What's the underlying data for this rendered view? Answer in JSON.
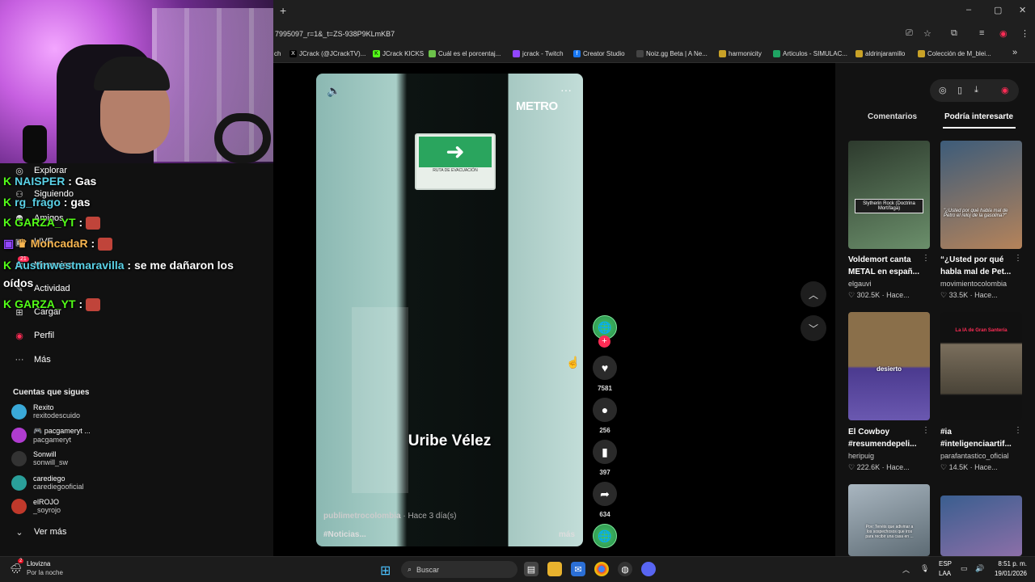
{
  "browser": {
    "new_tab": "+",
    "url": "7995097_r=1&_t=ZS-938P9KLmKB7",
    "window_controls": [
      "–",
      "▢",
      "✕"
    ],
    "bookmarks": [
      {
        "label": "ch",
        "icon": "tiktok-icon"
      },
      {
        "label": "JCrack (@JCrackTV)...",
        "icon": "x-icon"
      },
      {
        "label": "JCrack KICKS",
        "icon": "kick-icon"
      },
      {
        "label": "Cuál es el porcentaj...",
        "icon": "page-icon"
      },
      {
        "label": "jcrack - Twitch",
        "icon": "twitch-icon"
      },
      {
        "label": "Creator Studio",
        "icon": "facebook-icon"
      },
      {
        "label": "Noiz.gg Beta | A Ne...",
        "icon": "noiz-icon"
      },
      {
        "label": "harmonicity",
        "icon": "folder-icon"
      },
      {
        "label": "Articulos - SIMULAC...",
        "icon": "drive-icon"
      },
      {
        "label": "aldrinjaramillo",
        "icon": "folder-icon"
      },
      {
        "label": "Colección de M_blei...",
        "icon": "folder-icon"
      }
    ],
    "bookmarks_overflow": "»"
  },
  "chat": [
    {
      "user": "NAISPER",
      "sep": " : ",
      "msg": "Gas"
    },
    {
      "user": "rg_frago",
      "sep": " : ",
      "msg": "gas"
    },
    {
      "user": "GARZA_YT",
      "sep": " : ",
      "msg": ""
    },
    {
      "user": "MoncadaR",
      "sep": " : ",
      "msg": ""
    },
    {
      "user": "Austinwestmaravilla",
      "sep": " : ",
      "msg": "se me dañaron los"
    },
    {
      "user": "",
      "sep": "",
      "msg": "oídos"
    },
    {
      "user": "GARZA_YT",
      "sep": " : ",
      "msg": ""
    }
  ],
  "sidebar": {
    "nav": [
      {
        "label": "Explorar",
        "icon": "compass-icon"
      },
      {
        "label": "Siguiendo",
        "icon": "following-icon"
      },
      {
        "label": "Amigos",
        "icon": "friends-icon"
      },
      {
        "label": "LIVE",
        "icon": "live-icon"
      },
      {
        "label": "Mensajes",
        "icon": "messages-icon"
      },
      {
        "label": "Actividad",
        "icon": "activity-icon"
      },
      {
        "label": "Cargar",
        "icon": "upload-icon"
      },
      {
        "label": "Perfil",
        "icon": "profile-icon"
      },
      {
        "label": "Más",
        "icon": "more-icon"
      }
    ],
    "messages_badge": "21",
    "following_title": "Cuentas que sigues",
    "accounts": [
      {
        "name": "Rexito",
        "handle": "rexitodescuido",
        "color": "#3aa9d8"
      },
      {
        "name": "🎮 pacgameryt ...",
        "handle": "pacgameryt",
        "color": "#b03cd0"
      },
      {
        "name": "Sonwill",
        "handle": "sonwill_sw",
        "color": "#333333"
      },
      {
        "name": "carediego",
        "handle": "carediegooficial",
        "color": "#2a9f9a"
      },
      {
        "name": "elROJO",
        "handle": "_soyrojo",
        "color": "#c0392b"
      }
    ],
    "see_more": "Ver más"
  },
  "video": {
    "logo": "METRO",
    "exit_sign_arrow": "➜",
    "exit_sign_text": "RUTA DE EVACUACIÓN",
    "caption": "Uribe Vélez",
    "author": "publimetrocolombia",
    "time": " · Hace 3 día(s)",
    "tags": "#Noticias...",
    "more": "más"
  },
  "actions": {
    "likes": "7581",
    "comments": "256",
    "saves": "397",
    "shares": "634"
  },
  "right_panel": {
    "tabs": [
      "Comentarios",
      "Podría interesarte"
    ],
    "active_tab": 1,
    "cards": [
      {
        "title": "Voldemort canta METAL en españ...",
        "user": "elgauvi",
        "likes": "302.5K",
        "time": "Hace...",
        "thumb_text": "Slytherin Rock (Doctrina Mortífaga)",
        "c1": "#2d3a2d",
        "c2": "#6b8f6b"
      },
      {
        "title": "“¿Usted por qué habla mal de Pet...",
        "user": "movimientocolombia",
        "likes": "33.5K",
        "time": "Hace...",
        "thumb_text": "\"¿Usted por qué habla mal de Petro el reloj de la gasolina?\"",
        "c1": "#3d5c7a",
        "c2": "#b5835a"
      },
      {
        "title": "El Cowboy #resumendepeli...",
        "user": "heripuig",
        "likes": "222.6K",
        "time": "Hace...",
        "thumb_text": "desierto",
        "c1": "#8a6f4a",
        "c2": "#4b3a8f"
      },
      {
        "title": "#ia #inteligenciaartif...",
        "user": "parafantastico_oficial",
        "likes": "14.5K",
        "time": "Hace...",
        "thumb_text": "La IA de Gran Santería",
        "c1": "#111111",
        "c2": "#7a6e5c"
      },
      {
        "title": "",
        "user": "",
        "likes": "",
        "time": "",
        "thumb_text": "Pov: Tenéis que adivinar a los sospechosos que iros para recibir una casa en ...",
        "c1": "#a9b6c0",
        "c2": "#5d6b74"
      },
      {
        "title": "",
        "user": "",
        "likes": "",
        "time": "",
        "thumb_text": "",
        "c1": "#3a5e8f",
        "c2": "#8c6fa8"
      }
    ]
  },
  "taskbar": {
    "weather_title": "Llovizna",
    "weather_sub": "Por la noche",
    "weather_badge": "2",
    "search_placeholder": "Buscar",
    "lang": "ESP",
    "region": "LAA",
    "time": "8:51 p. m.",
    "date": "19/01/2026"
  }
}
